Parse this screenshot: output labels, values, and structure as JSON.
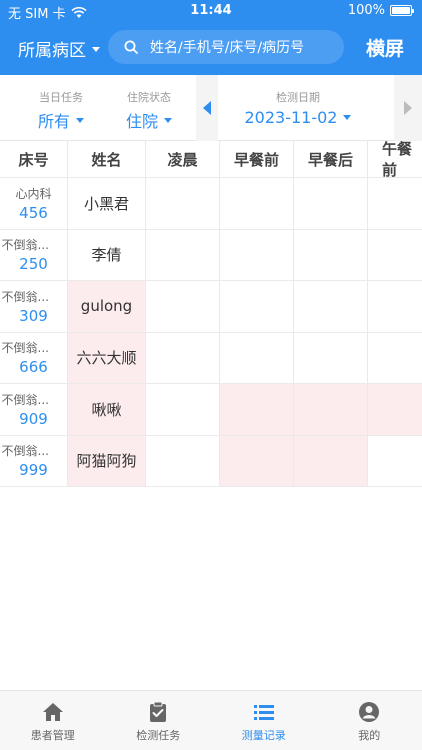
{
  "status_bar": {
    "carrier": "无 SIM 卡",
    "time": "11:44",
    "battery": "100%"
  },
  "header": {
    "ward_label": "所属病区",
    "search_placeholder": "姓名/手机号/床号/病历号",
    "landscape_label": "横屏"
  },
  "filters": {
    "task": {
      "label": "当日任务",
      "value": "所有"
    },
    "status": {
      "label": "住院状态",
      "value": "住院"
    },
    "date": {
      "label": "检测日期",
      "value": "2023-11-02"
    }
  },
  "table": {
    "columns": [
      "床号",
      "姓名",
      "凌晨",
      "早餐前",
      "早餐后",
      "午餐前"
    ],
    "rows": [
      {
        "dept": "心内科",
        "bed": "456",
        "name": "小黑君"
      },
      {
        "dept": "不倒翁...",
        "bed": "250",
        "name": "李倩"
      },
      {
        "dept": "不倒翁...",
        "bed": "309",
        "name": "gulong"
      },
      {
        "dept": "不倒翁...",
        "bed": "666",
        "name": "六六大顺"
      },
      {
        "dept": "不倒翁...",
        "bed": "909",
        "name": "啾啾"
      },
      {
        "dept": "不倒翁...",
        "bed": "999",
        "name": "阿猫阿狗"
      }
    ]
  },
  "tabs": [
    {
      "label": "患者管理",
      "icon": "home-icon"
    },
    {
      "label": "检测任务",
      "icon": "clipboard-check-icon"
    },
    {
      "label": "测量记录",
      "icon": "list-icon"
    },
    {
      "label": "我的",
      "icon": "user-icon"
    }
  ],
  "colors": {
    "primary": "#2e8ef0",
    "highlight": "#fcecee"
  }
}
